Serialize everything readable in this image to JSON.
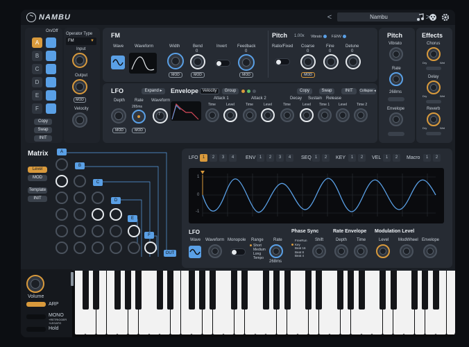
{
  "app": {
    "logo": "NAMBU",
    "preset_name": "Nambu",
    "prev_icon": "chevron-left-icon",
    "next_icon": "chevron-right-icon"
  },
  "operator": {
    "onoff_label": "On/Off",
    "ops": [
      "A",
      "B",
      "C",
      "D",
      "E",
      "F"
    ],
    "type_label": "Operator Type",
    "type_value": "FM",
    "input_label": "Input",
    "output_label": "Output",
    "velocity_label": "Velocity",
    "mod_label": "MOD",
    "copy": "Copy",
    "swap": "Swap",
    "init": "INIT"
  },
  "fm": {
    "title": "FM",
    "wave": "Wave",
    "waveform": "Waveform",
    "width": "Width",
    "bend": "Bend",
    "bend_value": "0",
    "invert": "Invert",
    "feedback": "Feedback",
    "feedback_value": "0",
    "mod": "MOD"
  },
  "pitch": {
    "title": "Pitch",
    "ratio_value": "1.00x",
    "vibrato_label": "Vibrato",
    "fenv_label": "F.ENV",
    "ratio_fixed": "Ratio/Fixed",
    "coarse": "Coarse",
    "coarse_value": "0",
    "fine": "Fine",
    "fine_value": "0",
    "detune": "Detune",
    "detune_value": "0",
    "mod": "MOD"
  },
  "lfo_top": {
    "title": "LFO",
    "expand": "Expand",
    "depth": "Depth",
    "rate": "Rate",
    "rate_value": "265ms",
    "waveform": "Waveform",
    "wave_value": "7",
    "mod": "MOD"
  },
  "envelope": {
    "title": "Envelope",
    "velocity": "Velocity",
    "group": "Group",
    "copy": "Copy",
    "swap": "Swap",
    "init": "INIT",
    "collapse": "Collapse",
    "attack1": "Attack 1",
    "attack2": "Attack 2",
    "decay": "Decay",
    "sustain": "Sustain",
    "release": "Release",
    "time": "Time",
    "level": "Level",
    "time1": "Time 1",
    "time2": "Time 2"
  },
  "pitch_side": {
    "title": "Pitch",
    "vibrato": "Vibrato",
    "rate": "Rate",
    "rate_value": "268ms",
    "envelope": "Envelope"
  },
  "effects": {
    "title": "Effects",
    "chorus": "Chorus",
    "delay": "Delay",
    "reverb": "Reverb",
    "dry": "Dry",
    "wet": "Wet"
  },
  "matrix": {
    "title": "Matrix",
    "level": "Level",
    "mod": "MOD",
    "template": "Template",
    "init": "INIT",
    "rows": [
      "A",
      "B",
      "C",
      "D",
      "E",
      "F"
    ],
    "out": "OUT"
  },
  "mod_tabs": {
    "lfo": "LFO",
    "lfo_nums": [
      "1",
      "2",
      "3",
      "4"
    ],
    "env": "ENV",
    "env_nums": [
      "1",
      "2",
      "3",
      "4"
    ],
    "seq": "SEQ",
    "seq_nums": [
      "1",
      "2"
    ],
    "key": "KEY",
    "key_nums": [
      "1",
      "2"
    ],
    "vel": "VEL",
    "vel_nums": [
      "1",
      "2"
    ],
    "macro": "Macro",
    "macro_nums": [
      "1",
      "2"
    ]
  },
  "scope": {
    "y_top": "1",
    "y_mid": "0",
    "y_bot": "-1"
  },
  "lfo_bottom": {
    "title": "LFO",
    "wave": "Wave",
    "waveform": "Waveform",
    "monopole": "Monopole",
    "range": "Range",
    "range_opts": [
      "Short",
      "Medium",
      "Long",
      "Tempo"
    ],
    "rate": "Rate",
    "rate_value": "268ms"
  },
  "phase": {
    "title": "Phase Sync",
    "shift": "Shift",
    "opts": [
      "FreeRun",
      "Key",
      "Beat 16",
      "Beat 8",
      "Beat 4"
    ]
  },
  "rate_env": {
    "title": "Rate Envelope",
    "depth": "Depth",
    "time": "Time"
  },
  "mod_level": {
    "title": "Modulation Level",
    "level": "Level",
    "modwheel": "ModWheel",
    "envelope": "Envelope"
  },
  "performance": {
    "volume": "Volume",
    "arp": "ARP",
    "mono": "MONO",
    "retrigger": "+RETRIGGER",
    "legato": "+LEGATO",
    "hold": "Hold"
  },
  "colors": {
    "accent": "#d99a3c",
    "blue": "#5aa0e6",
    "bg": "#1b1f25"
  }
}
